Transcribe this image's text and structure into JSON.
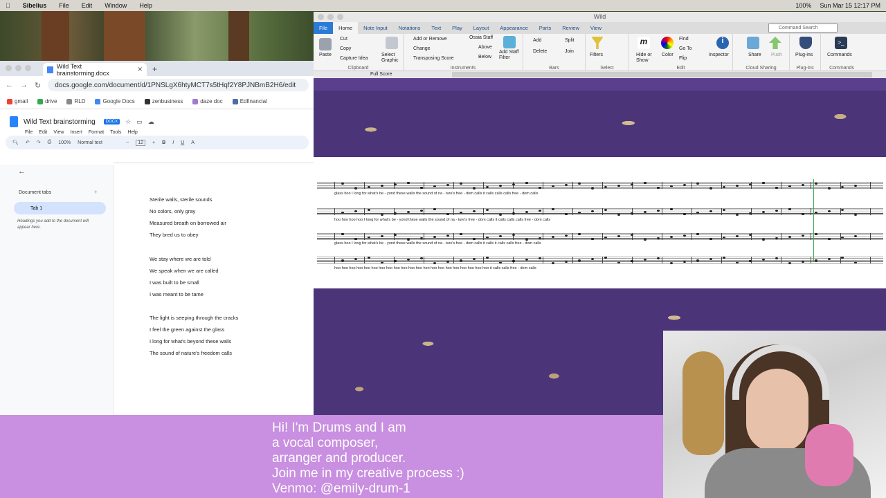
{
  "menubar": {
    "apple": "",
    "app": "Sibelius",
    "items": [
      "File",
      "Edit",
      "Window",
      "Help"
    ],
    "status": [
      "100%",
      "Sun Mar 15  12:17 PM"
    ]
  },
  "chrome": {
    "tab_title": "Wild Text brainstorming.docx",
    "url": "docs.google.com/document/d/1PNSLgX6htyMCT7s5tHqf2Y8PJNBmB2H6/edit",
    "bookmarks": [
      "gmail",
      "drive",
      "RLD",
      "Google Docs",
      "zenbusiness",
      "daze doc",
      "Edfinancial"
    ]
  },
  "docs": {
    "title": "Wild Text brainstorming",
    "badge": "DOCX",
    "menu": [
      "File",
      "Edit",
      "View",
      "Insert",
      "Format",
      "Tools",
      "Help"
    ],
    "zoom": "100%",
    "style": "Normal text",
    "font_size": "12",
    "sidebar": {
      "title": "Document tabs",
      "tab": "Tab 1",
      "note": "Headings you add to the document will appear here."
    },
    "stanzas": [
      [
        "Sterile walls, sterile sounds",
        "No colors, only gray",
        "Measured breath on borrowed air",
        "They bred us to obey"
      ],
      [
        "We stay where we are told",
        "We speak when we are called",
        "I was built to be small",
        "I was meant to be tame"
      ],
      [
        "The light is seeping through the cracks",
        "I feel the green against the glass",
        "I long for what's beyond these walls",
        "The sound of nature's freedom calls"
      ]
    ]
  },
  "sibelius": {
    "title": "Wild",
    "tabs": [
      "File",
      "Home",
      "Note Input",
      "Notations",
      "Text",
      "Play",
      "Layout",
      "Appearance",
      "Parts",
      "Review",
      "View"
    ],
    "active_tab": "Home",
    "command_search": "Command Search",
    "clipboard": {
      "label": "Clipboard",
      "paste": "Paste",
      "cut": "Cut",
      "copy": "Copy",
      "capture": "Capture Idea",
      "select_graphic": "Select Graphic"
    },
    "instruments": {
      "label": "Instruments",
      "add_remove": "Add or Remove",
      "change": "Change",
      "transposing": "Transposing Score",
      "ossia": "Ossia Staff",
      "above": "Above",
      "below": "Below",
      "add_staff_filter": "Add Staff Filter"
    },
    "bars": {
      "label": "Bars",
      "add": "Add",
      "delete": "Delete",
      "split": "Split",
      "join": "Join"
    },
    "select": {
      "label": "Select",
      "filters": "Filters"
    },
    "edit": {
      "label": "Edit",
      "hide_show": "Hide or Show",
      "color": "Color",
      "find": "Find",
      "goto": "Go To",
      "flip": "Flip",
      "inspector": "Inspector"
    },
    "cloud": {
      "label": "Cloud Sharing",
      "share": "Share",
      "push": "Push"
    },
    "plugins": {
      "label": "Plug-ins",
      "plugins": "Plug-ins"
    },
    "commands": {
      "label": "Commands",
      "commands": "Commands"
    },
    "score_tab": "Full Score",
    "lyrics": [
      "glass   hoo   I   long   for what's  be - yond   these   walls   the sound   of   na - ture's  free - dom   calls   it calls   calls   calls   free -  dom   calls",
      "hoo  hoo   hoo  hoo   I  long   for what's  be - yond   these   walls   the sound   of   na - ture's  free - dom   calls   it calls   calls   calls   free -  dom   calls",
      "glass   hoo   I   long   for what's  be - yond   these   walls   the sound   of   na - ture's  free - dom   calls   it calls   it calls   calls   free -  dom   calls",
      "hoo  hoo  hoo  hoo  hoo  hoo  hoo  hoo  hoo  hoo  hoo  hoo  hoo  hoo  hoo  hoo  hoo  hoo  hoo  hoo  hoo   it calls   calls   free -  dom   calls"
    ]
  },
  "banner": {
    "lines": [
      "Hi! I'm Drums and I am",
      "a vocal composer,",
      "arranger and producer.",
      "Join me in my creative process :)",
      "Venmo: @emily-drum-1"
    ],
    "color": "#c98fe0"
  }
}
